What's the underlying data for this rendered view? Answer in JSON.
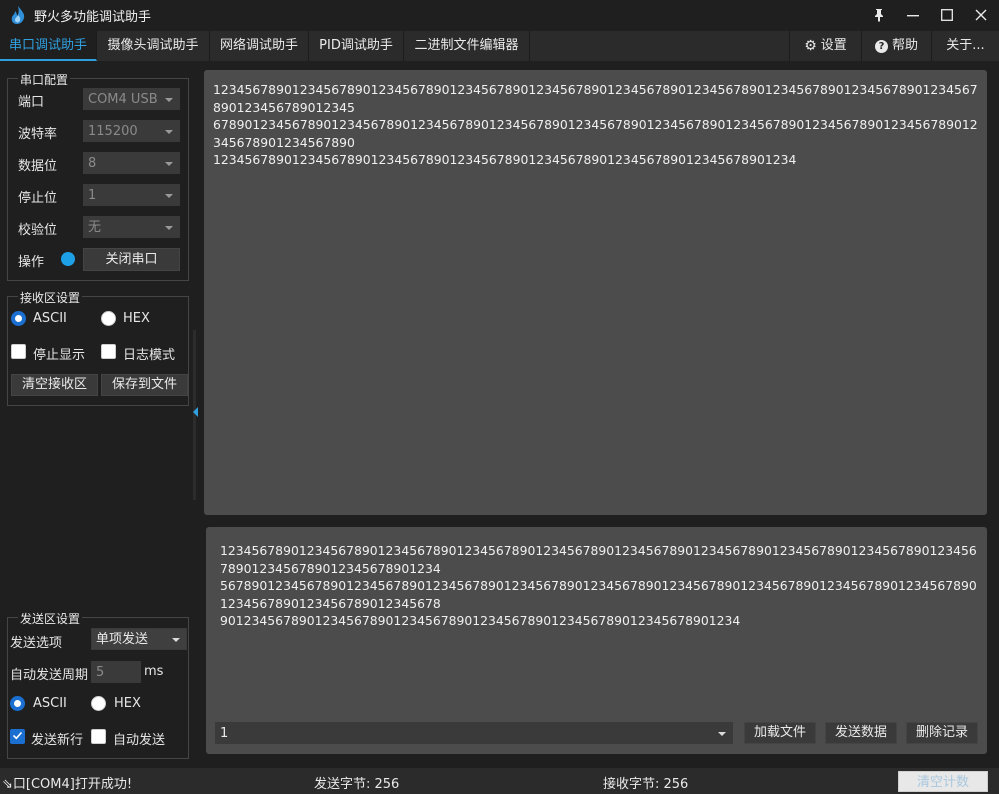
{
  "window": {
    "title": "野火多功能调试助手",
    "pin_glyph": "📌",
    "min_glyph": "—",
    "max_glyph": "☐",
    "close_glyph": "✕"
  },
  "tabs": [
    {
      "label": "串口调试助手",
      "active": true
    },
    {
      "label": "摄像头调试助手",
      "active": false
    },
    {
      "label": "网络调试助手",
      "active": false
    },
    {
      "label": "PID调试助手",
      "active": false
    },
    {
      "label": "二进制文件编辑器",
      "active": false
    }
  ],
  "right_tabs": {
    "settings_glyph": "⚙",
    "settings": "设置",
    "help_glyph": "?",
    "help": "帮助",
    "about": "关于..."
  },
  "serial_config": {
    "title": "串口配置",
    "port_label": "端口",
    "port_value": "COM4 USB",
    "baud_label": "波特率",
    "baud_value": "115200",
    "databits_label": "数据位",
    "databits_value": "8",
    "stopbits_label": "停止位",
    "stopbits_value": "1",
    "parity_label": "校验位",
    "parity_value": "无",
    "op_label": "操作",
    "close_port_button": "关闭串口"
  },
  "receive_settings": {
    "title": "接收区设置",
    "ascii": "ASCII",
    "hex": "HEX",
    "ascii_selected": true,
    "stop_display": "停止显示",
    "log_mode": "日志模式",
    "clear_button": "清空接收区",
    "save_button": "保存到文件"
  },
  "send_settings": {
    "title": "发送区设置",
    "send_option_label": "发送选项",
    "send_option_value": "单项发送",
    "auto_period_label": "自动发送周期",
    "auto_period_value": "5",
    "auto_period_unit": "ms",
    "ascii": "ASCII",
    "hex": "HEX",
    "ascii_selected": true,
    "send_newline": "发送新行",
    "send_newline_checked": true,
    "auto_send": "自动发送",
    "auto_send_checked": false
  },
  "receive_area": {
    "lines": [
      "1234567890123456789012345678901234567890123456789012345678901234567890123456789012345678901234567890123456789012345",
      "6789012345678901234567890123456789012345678901234567890123456789012345678901234567890123456789012345678901234567890",
      "12345678901234567890123456789012345678901234567890123456789012345678901234"
    ]
  },
  "send_area": {
    "lines": [
      "1234567890123456789012345678901234567890123456789012345678901234567890123456789012345678901234567890123456789012345678901234",
      "5678901234567890123456789012345678901234567890123456789012345678901234567890123456789012345678901234567890123456789012345678",
      "901234567890123456789012345678901234567890123456789012345678901234"
    ],
    "history_value": "1",
    "load_file_button": "加载文件",
    "send_data_button": "发送数据",
    "delete_record_button": "删除记录"
  },
  "status": {
    "message": "⇘口[COM4]打开成功!",
    "sent_bytes": "发送字节: 256",
    "received_bytes": "接收字节: 256",
    "clear_count_button": "清空计数"
  }
}
